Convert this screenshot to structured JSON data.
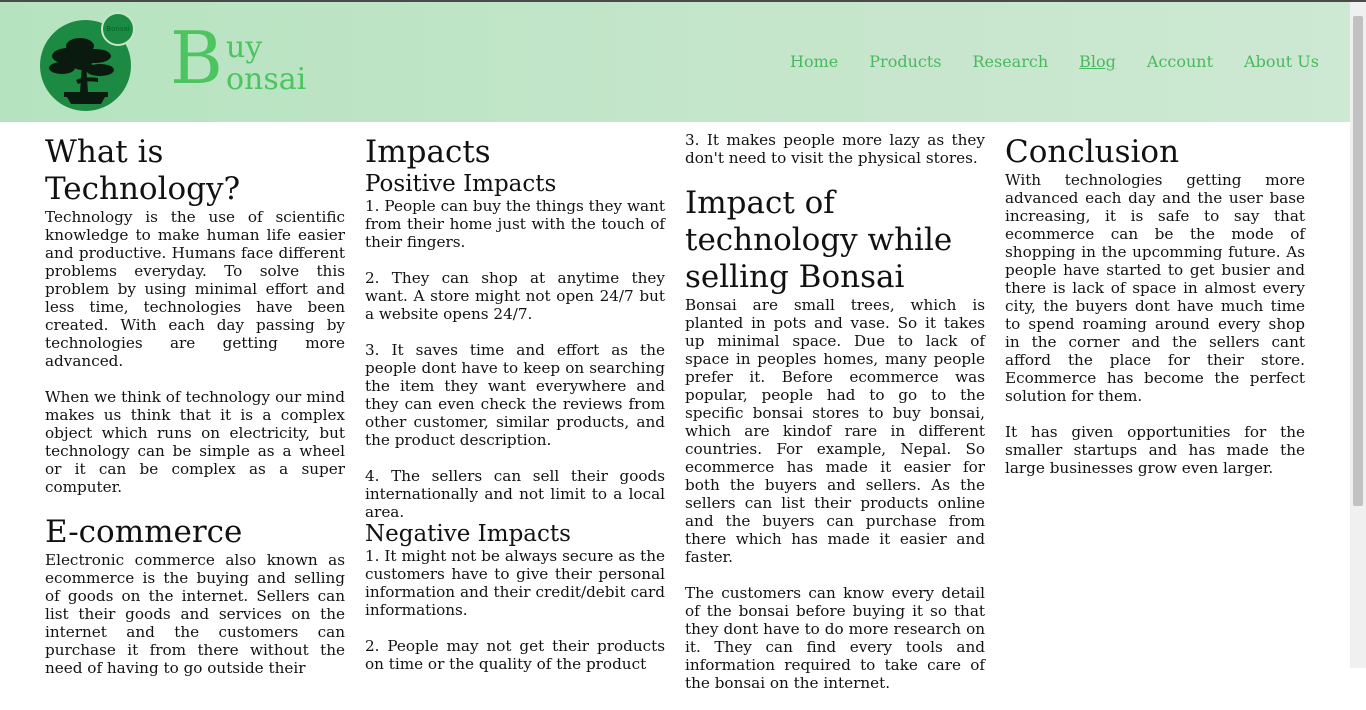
{
  "brand": {
    "b": "B",
    "uy": "uy",
    "onsai": "onsai",
    "badge": "Bonsai"
  },
  "nav": [
    "Home",
    "Products",
    "Research",
    "Blog",
    "Account",
    "About Us"
  ],
  "col1": {
    "title1": "What is Technology?",
    "p1": "Technology is the use of scientific knowledge to make human life easier and productive. Humans face different problems everyday. To solve this problem by using minimal effort and less time, technologies have been created. With each day passing by technologies are getting more advanced.",
    "p2": "When we think of technology our mind makes us think that it is a complex object which runs on electricity, but technology can be simple as a wheel or it can be complex as a super computer.",
    "title2": "E-commerce",
    "p3": "Electronic commerce also known as ecommerce is the buying and selling of goods on the internet. Sellers can list their goods and services on the internet and the customers can purchase it from there without the need of having to go outside their"
  },
  "col2": {
    "title": "Impacts",
    "sub1": "Positive Impacts",
    "pos": [
      "1. People can buy the things they want from their home just with the touch of their fingers.",
      "2. They can shop at anytime they want. A store might not open 24/7 but a website opens 24/7.",
      "3. It saves time and effort as the people dont have to keep on searching the item they want everywhere and they can even check the reviews from other customer, similar products, and the product description.",
      "4. The sellers can sell their goods internationally and not limit to a local area."
    ],
    "sub2": "Negative Impacts",
    "neg": [
      "1. It might not be always secure as the customers have to give their personal information and their credit/debit card informations.",
      "2. People may not get their products on time or the quality of the product"
    ]
  },
  "col3": {
    "p0": "3. It makes people more lazy as they don't need to visit the physical stores.",
    "title": "Impact of technology while selling Bonsai",
    "p1": "Bonsai are small trees, which is planted in pots and vase. So it takes up minimal space. Due to lack of space in peoples homes, many people prefer it. Before ecommerce was popular, people had to go to the specific bonsai stores to buy bonsai, which are kindof rare in different countries. For example, Nepal. So ecommerce has made it easier for both the buyers and sellers. As the sellers can list their products online and the buyers can purchase from there which has made it easier and faster.",
    "p2": "The customers can know every detail of the bonsai before buying it so that they dont have to do more research on it. They can find every tools and information required to take care of the bonsai on the internet."
  },
  "col4": {
    "title": "Conclusion",
    "p1": "With technologies getting more advanced each day and the user base increasing, it is safe to say that ecommerce can be the mode of shopping in the upcomming future. As people have started to get busier and there is lack of space in almost every city, the buyers dont have much time to spend roaming around every shop in the corner and the sellers cant afford the place for their store. Ecommerce has become the perfect solution for them.",
    "p2": "It has given opportunities for the smaller startups and has made the large businesses grow even larger."
  }
}
